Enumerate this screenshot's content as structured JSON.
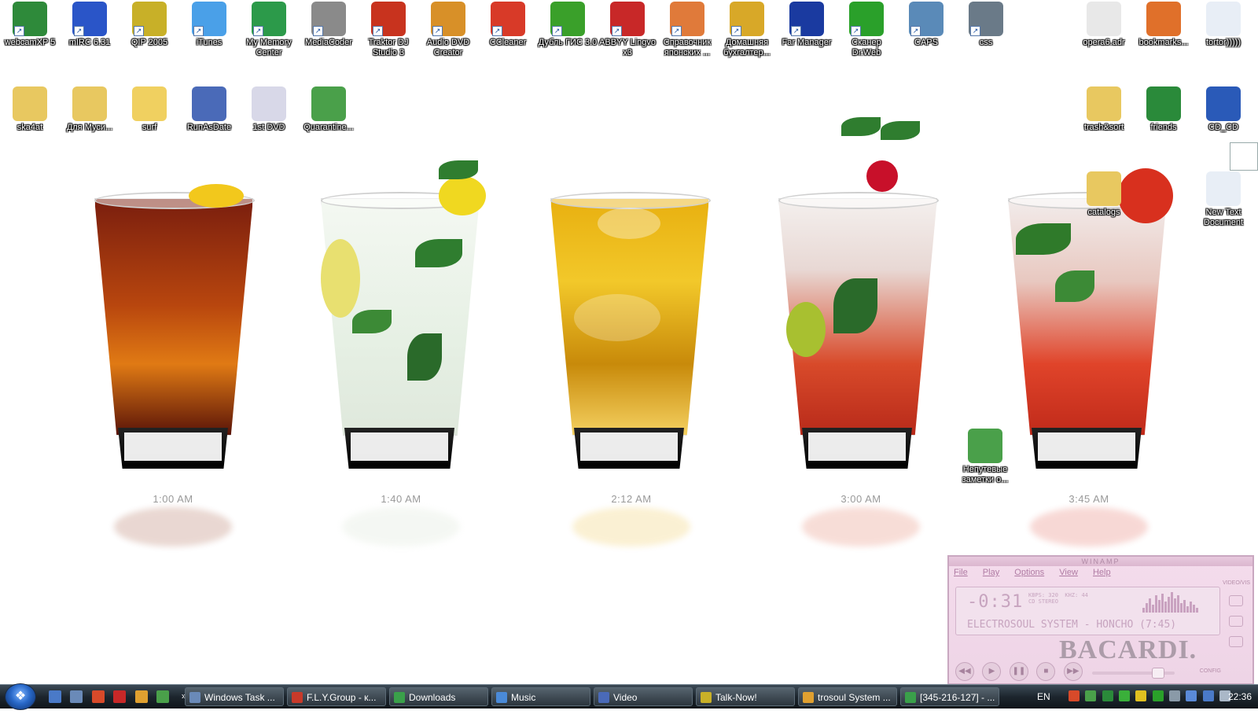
{
  "desktop": {
    "top_icons": [
      {
        "label": "webcamXP 5",
        "icon": "webcam-icon",
        "color": "#2e8a3a"
      },
      {
        "label": "mIRC 6.31",
        "icon": "mirc-icon",
        "color": "#2a55c8"
      },
      {
        "label": "QIP 2005",
        "icon": "qip-icon",
        "color": "#c8b028"
      },
      {
        "label": "iTunes",
        "icon": "itunes-icon",
        "color": "#4aa0e8"
      },
      {
        "label": "My Memory Center",
        "icon": "memory-center-icon",
        "color": "#2c9a4a"
      },
      {
        "label": "MediaCoder",
        "icon": "mediacoder-icon",
        "color": "#8a8a8a"
      },
      {
        "label": "Traktor DJ Studio 3",
        "icon": "traktor-icon",
        "color": "#c8331e"
      },
      {
        "label": "Audio DVD Creator",
        "icon": "audio-dvd-icon",
        "color": "#d89028"
      },
      {
        "label": "CCleaner",
        "icon": "ccleaner-icon",
        "color": "#d83a28"
      },
      {
        "label": "Дубль ГИС 3.0",
        "icon": "2gis-icon",
        "color": "#3aa02a"
      },
      {
        "label": "ABBYY Lingvo x3",
        "icon": "lingvo-icon",
        "color": "#c82828"
      },
      {
        "label": "Справочник японских ...",
        "icon": "japanese-dict-icon",
        "color": "#e07a3a"
      },
      {
        "label": "Домашняя бухгалтер...",
        "icon": "home-accounting-icon",
        "color": "#d8a828"
      },
      {
        "label": "Far Manager",
        "icon": "far-manager-icon",
        "color": "#1a3aa0"
      },
      {
        "label": "Сканер Dr.Web",
        "icon": "drweb-icon",
        "color": "#2aa02a"
      },
      {
        "label": "CAPS",
        "icon": "caps-icon",
        "color": "#5a8ab8"
      },
      {
        "label": "css",
        "icon": "css-icon",
        "color": "#6a7a88"
      }
    ],
    "top_right_icons": [
      {
        "label": "opera6.adr",
        "icon": "document-icon",
        "color": "#e8e8e8"
      },
      {
        "label": "bookmarks...",
        "icon": "firefox-icon",
        "color": "#e0702a"
      },
      {
        "label": "tortor)))))",
        "icon": "text-document-icon",
        "color": "#e8eef6"
      }
    ],
    "second_row_icons": [
      {
        "label": "ska4at",
        "icon": "folder-icon",
        "color": "#e8c860"
      },
      {
        "label": "Для Муси...",
        "icon": "folder-icon",
        "color": "#e8c860"
      },
      {
        "label": "surf",
        "icon": "script-icon",
        "color": "#f0d060"
      },
      {
        "label": "RunAsDate",
        "icon": "calendar-icon",
        "color": "#4a6ab8"
      },
      {
        "label": "1st DVD",
        "icon": "dvd-icon",
        "color": "#d8d8e8"
      },
      {
        "label": "Quarantine...",
        "icon": "utorrent-icon",
        "color": "#4aa04a"
      }
    ],
    "right_column_icons": [
      {
        "label": "trash&sort",
        "icon": "folder-icon",
        "color": "#e8c860"
      },
      {
        "label": "friends",
        "icon": "excel-icon",
        "color": "#2a8a3a"
      },
      {
        "label": "CD_CD",
        "icon": "word-icon",
        "color": "#2a5ab8"
      },
      {
        "label": "catalogs",
        "icon": "folder-icon",
        "color": "#e8c860"
      },
      {
        "label": "New Text Document",
        "icon": "text-document-icon",
        "color": "#e8eef6"
      },
      {
        "label": "Непутевые заметки о...",
        "icon": "utorrent-icon",
        "color": "#4aa04a"
      }
    ]
  },
  "wallpaper": {
    "times": [
      "1:00 AM",
      "1:40 AM",
      "2:12 AM",
      "3:00 AM",
      "3:45 AM"
    ]
  },
  "winamp": {
    "title": "WINAMP",
    "menu": [
      "File",
      "Play",
      "Options",
      "View",
      "Help"
    ],
    "timer": "-0:31",
    "kbps": "320",
    "khz": "44",
    "stereo": "CD STEREO",
    "track": "ELECTROSOUL SYSTEM - HONCHO (7:45)",
    "brand": "BACARDI.",
    "config_label": "CONFIG",
    "side_label": "VIDEO/VIS"
  },
  "taskbar": {
    "more_label": "»",
    "tasks": [
      {
        "label": "Windows Task ...",
        "icon_color": "#6a8ab8"
      },
      {
        "label": "F.L.Y.Group - к...",
        "icon_color": "#c83a2a"
      },
      {
        "label": "Downloads",
        "icon_color": "#3aa04a"
      },
      {
        "label": "Music",
        "icon_color": "#4a8ad8"
      },
      {
        "label": "Video",
        "icon_color": "#4a6ab8"
      },
      {
        "label": "Talk-Now!",
        "icon_color": "#c8b028"
      },
      {
        "label": "trosoul System ...",
        "icon_color": "#e0a030"
      },
      {
        "label": "[345-216-127] - ...",
        "icon_color": "#3aa04a"
      }
    ],
    "language": "EN",
    "clock": "22:36"
  }
}
